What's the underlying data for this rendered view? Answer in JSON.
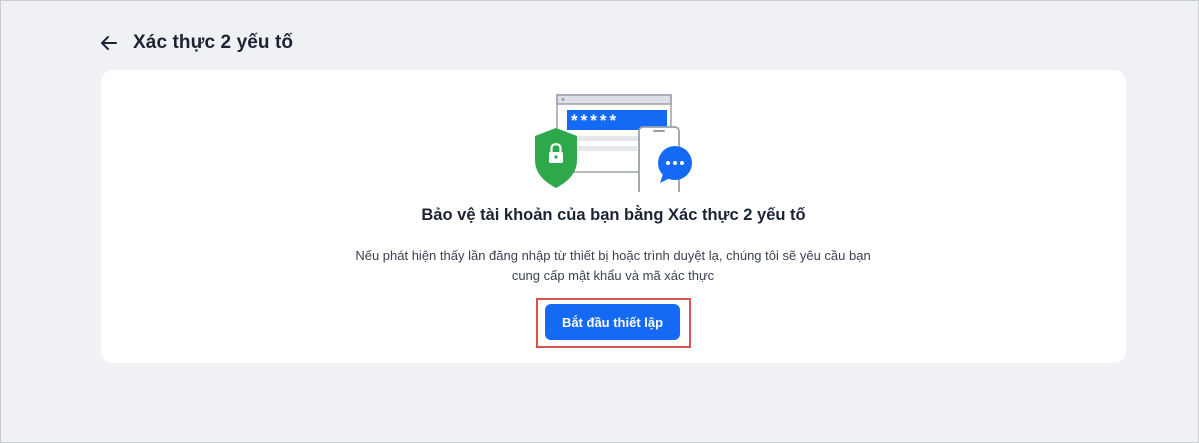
{
  "header": {
    "title": "Xác thực 2 yếu tố"
  },
  "card": {
    "heading": "Bảo vệ tài khoản của bạn bằng Xác thực 2 yếu tố",
    "description_line1": "Nếu phát hiện thấy lần đăng nhập từ thiết bị hoặc trình duyệt lạ, chúng tôi sẽ yêu cầu bạn",
    "description_line2": "cung cấp mật khẩu và mã xác thực",
    "password_mask": "*****",
    "start_button_label": "Bắt đầu thiết lập"
  },
  "icons": {
    "back": "arrow-left-icon",
    "shield": "shield-lock-icon",
    "chat": "chat-bubble-icon"
  },
  "colors": {
    "primary": "#1469f5",
    "shield_green": "#2ea84a",
    "highlight": "#d9534f"
  }
}
